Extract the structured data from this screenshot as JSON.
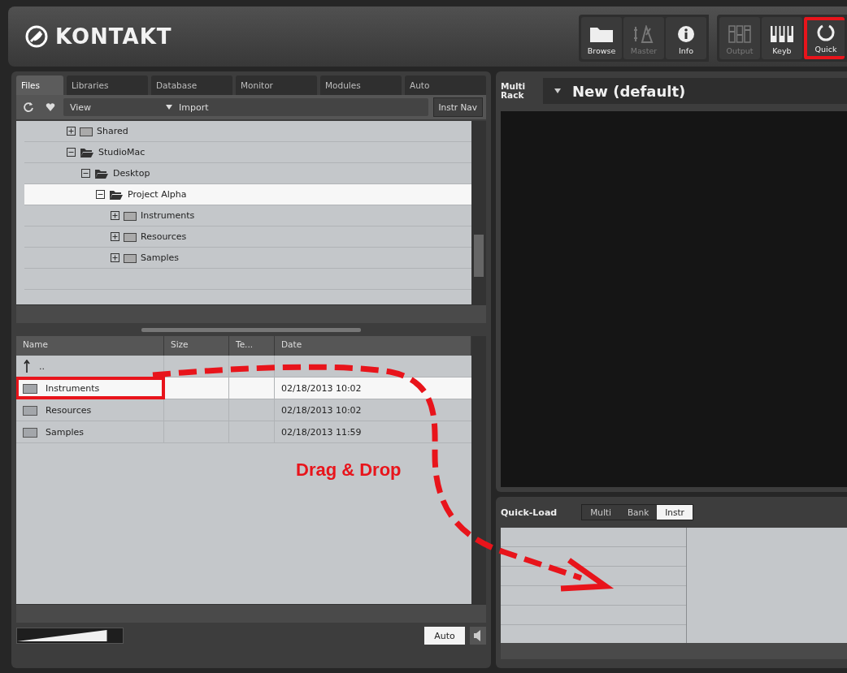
{
  "header": {
    "logo": "KONTAKT",
    "tool_groups": [
      {
        "tools": [
          {
            "kind": "folder",
            "label": "Browse",
            "disabled": false,
            "highlighted": false
          },
          {
            "kind": "master",
            "label": "Master",
            "disabled": true,
            "highlighted": false
          },
          {
            "kind": "info",
            "label": "Info",
            "disabled": false,
            "highlighted": false
          }
        ]
      },
      {
        "tools": [
          {
            "kind": "output",
            "label": "Output",
            "disabled": true,
            "highlighted": false
          },
          {
            "kind": "keyboard",
            "label": "Keyb",
            "disabled": false,
            "highlighted": false
          },
          {
            "kind": "quick",
            "label": "Quick",
            "disabled": false,
            "highlighted": true
          }
        ]
      }
    ]
  },
  "browser": {
    "tabs": [
      {
        "label": "Files",
        "selected": true
      },
      {
        "label": "Libraries",
        "selected": false
      },
      {
        "label": "Database",
        "selected": false
      },
      {
        "label": "Monitor",
        "selected": false
      },
      {
        "label": "Modules",
        "selected": false
      },
      {
        "label": "Auto",
        "selected": false
      }
    ],
    "toolbar": {
      "view": "View",
      "import": "Import",
      "instr_nav": "Instr Nav"
    },
    "tree": [
      {
        "name": "Shared",
        "expanded": false,
        "selected": false
      },
      {
        "name": "StudioMac",
        "expanded": true,
        "selected": false,
        "children": [
          {
            "name": "Desktop",
            "expanded": true,
            "selected": false,
            "children": [
              {
                "name": "Project Alpha",
                "expanded": true,
                "selected": true,
                "children": [
                  {
                    "name": "Instruments",
                    "expanded": false,
                    "selected": false
                  },
                  {
                    "name": "Resources",
                    "expanded": false,
                    "selected": false
                  },
                  {
                    "name": "Samples",
                    "expanded": false,
                    "selected": false
                  }
                ]
              }
            ]
          }
        ]
      }
    ],
    "file_list": {
      "columns": [
        "Name",
        "Size",
        "Te...",
        "Date"
      ],
      "rows": [
        {
          "kind": "parent",
          "name": "..",
          "date": "",
          "selected": false,
          "highlighted": false
        },
        {
          "kind": "folder",
          "name": "Instruments",
          "date": "02/18/2013 10:02",
          "selected": true,
          "highlighted": true
        },
        {
          "kind": "folder",
          "name": "Resources",
          "date": "02/18/2013 10:02",
          "selected": false,
          "highlighted": false
        },
        {
          "kind": "folder",
          "name": "Samples",
          "date": "02/18/2013 11:59",
          "selected": false,
          "highlighted": false
        }
      ]
    },
    "footer": {
      "volume": {
        "level": 0.85
      },
      "auto": "Auto"
    }
  },
  "rack": {
    "label": "Multi Rack",
    "preset": "New (default)"
  },
  "quick_load": {
    "title": "Quick-Load",
    "tabs": [
      {
        "label": "Multi",
        "selected": false
      },
      {
        "label": "Bank",
        "selected": false
      },
      {
        "label": "Instr",
        "selected": true
      }
    ]
  },
  "annotation": {
    "label": "Drag & Drop"
  }
}
